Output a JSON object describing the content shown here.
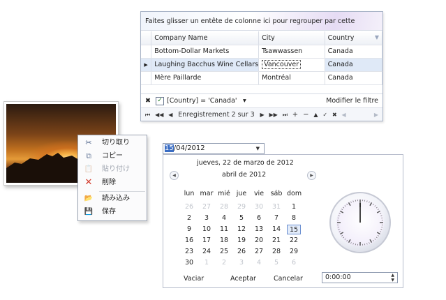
{
  "grid": {
    "group_panel_text": "Faites glisser un entête de colonne ici pour regrouper par cette colonne",
    "columns": [
      "Company Name",
      "City",
      "Country"
    ],
    "rows": [
      [
        "Bottom-Dollar Markets",
        "Tsawwassen",
        "Canada"
      ],
      [
        "Laughing Bacchus Wine Cellars",
        "Vancouver",
        "Canada"
      ],
      [
        "Mère Paillarde",
        "Montréal",
        "Canada"
      ]
    ],
    "selected_row_index": 1,
    "filter": {
      "close_glyph": "✖",
      "check_glyph": "✓",
      "expression": "[Country] = 'Canada'",
      "dropdown_glyph": "▾",
      "edit_label": "Modifier le filtre"
    },
    "navigator": {
      "first": "⏮",
      "prev_page": "◀◀",
      "prev": "◀",
      "record_text": "Enregistrement 2 sur 3",
      "next": "▶",
      "next_page": "▶▶",
      "last": "⏭",
      "append": "+",
      "remove": "−",
      "edit": "▲",
      "end_edit": "✓",
      "cancel": "✖",
      "scroll_left": "◀",
      "scroll_right": "▶"
    }
  },
  "context_menu": {
    "items": [
      {
        "label": "切り取り",
        "icon": "scissors-icon",
        "glyph": "✂",
        "enabled": true
      },
      {
        "label": "コピー",
        "icon": "copy-icon",
        "glyph": "⧉",
        "enabled": true
      },
      {
        "label": "貼り付け",
        "icon": "paste-icon",
        "glyph": "📋",
        "enabled": false
      },
      {
        "label": "削除",
        "icon": "delete-icon",
        "glyph": "✕",
        "enabled": true
      },
      {
        "label": "読み込み",
        "icon": "open-folder-icon",
        "glyph": "📂",
        "enabled": true
      },
      {
        "label": "保存",
        "icon": "save-disk-icon",
        "glyph": "💾",
        "enabled": true
      }
    ]
  },
  "date_edit": {
    "selected_part": "15",
    "rest": "/04/2012",
    "dropdown_glyph": "▼"
  },
  "calendar": {
    "today_text": "jueves, 22 de marzo de 2012",
    "month_text": "abril de 2012",
    "prev_glyph": "◀",
    "next_glyph": "▶",
    "weekdays": [
      "lun",
      "mar",
      "mié",
      "jue",
      "vie",
      "sáb",
      "dom"
    ],
    "weeks": [
      [
        [
          "26",
          1
        ],
        [
          "27",
          1
        ],
        [
          "28",
          1
        ],
        [
          "29",
          1
        ],
        [
          "30",
          1
        ],
        [
          "31",
          1
        ],
        [
          "1",
          0
        ]
      ],
      [
        [
          "2",
          0
        ],
        [
          "3",
          0
        ],
        [
          "4",
          0
        ],
        [
          "5",
          0
        ],
        [
          "6",
          0
        ],
        [
          "7",
          0
        ],
        [
          "8",
          0
        ]
      ],
      [
        [
          "9",
          0
        ],
        [
          "10",
          0
        ],
        [
          "11",
          0
        ],
        [
          "12",
          0
        ],
        [
          "13",
          0
        ],
        [
          "14",
          0
        ],
        [
          "15",
          2
        ]
      ],
      [
        [
          "16",
          0
        ],
        [
          "17",
          0
        ],
        [
          "18",
          0
        ],
        [
          "19",
          0
        ],
        [
          "20",
          0
        ],
        [
          "21",
          0
        ],
        [
          "22",
          0
        ]
      ],
      [
        [
          "23",
          0
        ],
        [
          "24",
          0
        ],
        [
          "25",
          0
        ],
        [
          "26",
          0
        ],
        [
          "27",
          0
        ],
        [
          "28",
          0
        ],
        [
          "29",
          0
        ]
      ],
      [
        [
          "30",
          0
        ],
        [
          "1",
          1
        ],
        [
          "2",
          1
        ],
        [
          "3",
          1
        ],
        [
          "4",
          1
        ],
        [
          "5",
          1
        ],
        [
          "6",
          1
        ]
      ]
    ],
    "buttons": {
      "clear": "Vaciar",
      "ok": "Aceptar",
      "cancel": "Cancelar"
    },
    "time_value": "0:00:00",
    "spin_up": "▲",
    "spin_down": "▼"
  },
  "colors": {
    "selection_blue": "#3a6dc4",
    "row_highlight": "#dfe9f7",
    "border": "#a9b4c7"
  }
}
